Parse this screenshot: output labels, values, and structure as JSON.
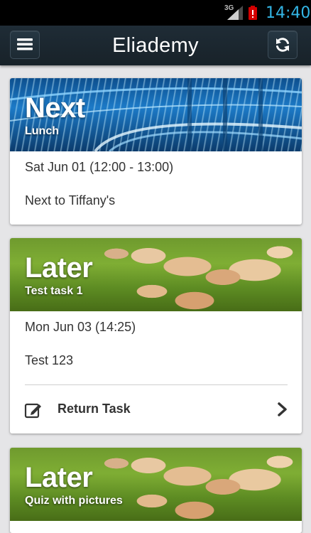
{
  "status_bar": {
    "network": "3G",
    "time": "14:40"
  },
  "app_bar": {
    "title": "Eliademy",
    "menu_icon": "hamburger-menu-icon",
    "refresh_icon": "refresh-icon"
  },
  "cards": [
    {
      "heading": "Next",
      "subtitle": "Lunch",
      "image": "city-highway",
      "datetime": "Sat Jun 01 (12:00 - 13:00)",
      "detail": "Next to Tiffany's"
    },
    {
      "heading": "Later",
      "subtitle": "Test task 1",
      "image": "mushrooms",
      "datetime": "Mon Jun 03 (14:25)",
      "detail": "Test 123",
      "action": {
        "label": "Return Task",
        "icon": "edit-icon",
        "trailing_icon": "chevron-right-icon"
      }
    },
    {
      "heading": "Later",
      "subtitle": "Quiz with pictures",
      "image": "mushrooms"
    }
  ],
  "colors": {
    "status_clock": "#33b5e5",
    "app_bar": "#1d2a33",
    "background": "#e5e5e7"
  }
}
